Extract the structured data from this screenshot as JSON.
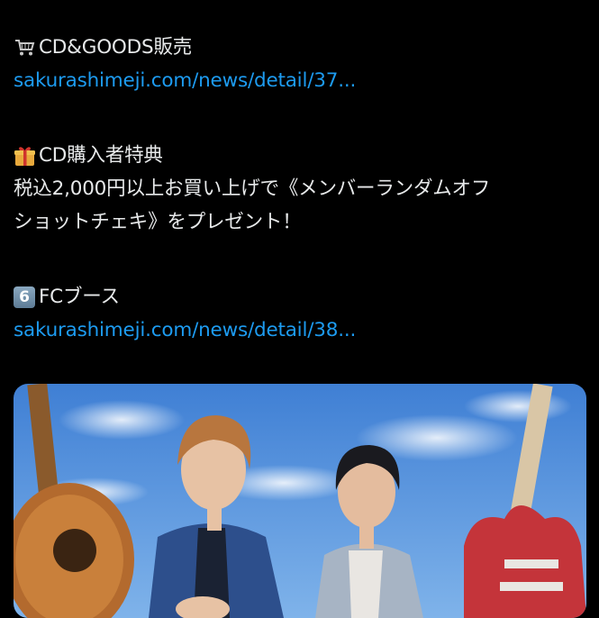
{
  "tweet": {
    "section1": {
      "icon": "shopping-cart-icon",
      "heading": "CD&GOODS販売",
      "link": "sakurashimeji.com/news/detail/37..."
    },
    "section2": {
      "icon": "gift-icon",
      "heading": "CD購入者特典",
      "body_line1": "税込2,000円以上お買い上げで《メンバーランダムオフ",
      "body_line2": "ショットチェキ》をプレゼント！"
    },
    "section3": {
      "icon": "keycap-6-icon",
      "keycap_text": "6",
      "heading": "FCブース",
      "link": "sakurashimeji.com/news/detail/38..."
    }
  },
  "media": {
    "kind": "photo",
    "description_icon": "band-photo"
  },
  "colors": {
    "background": "#000000",
    "text": "#e7e9ea",
    "link": "#1d9bf0"
  }
}
